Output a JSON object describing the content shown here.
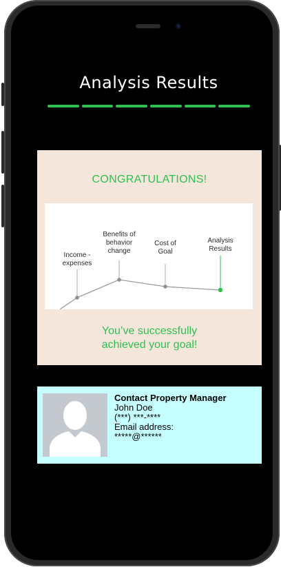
{
  "screen": {
    "title": "Analysis Results",
    "progress_steps": 6,
    "progress_completed": 6
  },
  "congrats": {
    "heading": "CONGRATULATIONS!",
    "message_line1": "You’ve successfully",
    "message_line2": "achieved your goal!"
  },
  "journey_chart": {
    "steps": [
      {
        "label": "Income - expenses",
        "line1": "Income -",
        "line2": "expenses"
      },
      {
        "label": "Benefits of behavior change",
        "line1": "Benefits of",
        "line2": "behavior",
        "line3": "change"
      },
      {
        "label": "Cost of Goal",
        "line1": "Cost of",
        "line2": "Goal"
      },
      {
        "label": "Analysis Results",
        "line1": "Analysis",
        "line2": "Results"
      }
    ],
    "current_step": "Analysis Results"
  },
  "contact": {
    "title": "Contact Property Manager",
    "name": "John Doe",
    "phone": "(***) ***-****",
    "email_label": "Email address:",
    "email_value": "*****@******"
  },
  "colors": {
    "accent_green": "#2fbf52",
    "card_beige": "#f4e6da",
    "contact_cyan": "#c5ffff",
    "screen_bg": "#000000"
  },
  "icons": {
    "avatar": "user-placeholder-icon"
  }
}
